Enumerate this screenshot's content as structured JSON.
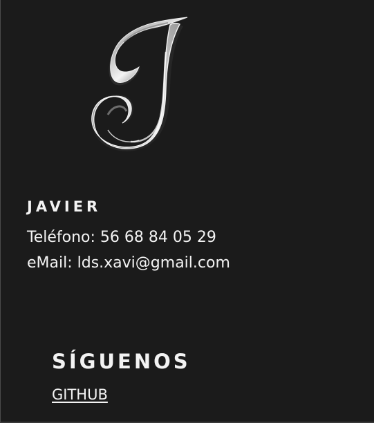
{
  "profile": {
    "logo_icon": "chrome-script-letter-j-icon",
    "name": "JAVIER",
    "phone": "Teléfono: 56 68 84 05 29",
    "email": "eMail: lds.xavi@gmail.com"
  },
  "social": {
    "title": "SÍGUENOS",
    "github_label": "GITHUB"
  },
  "colors": {
    "background": "#1b1b1b",
    "text": "#f3f3f3",
    "logo_metal": "#d9d9d9"
  }
}
